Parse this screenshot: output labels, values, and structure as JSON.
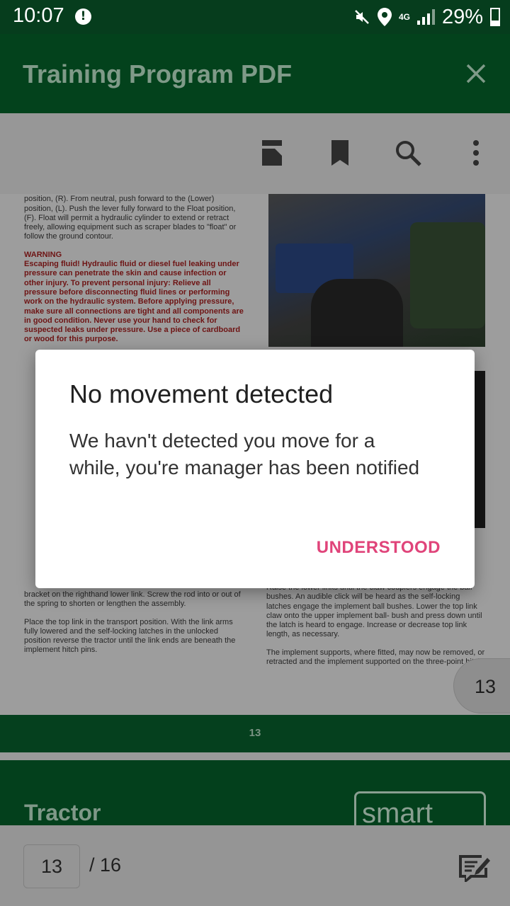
{
  "status_bar": {
    "time": "10:07",
    "network": "4G",
    "battery": "29%"
  },
  "app_bar": {
    "title": "Training Program PDF"
  },
  "toolbar": {
    "icons": [
      "page-layout-icon",
      "bookmark-icon",
      "search-icon",
      "more-vert-icon"
    ]
  },
  "pdf": {
    "left_column": [
      "Pull the lever back from the neutral position, (N), to the Raise position, (R). From neutral, push forward to the (Lower) position, (L). Push the lever fully forward to the Float position, (F). Float will permit a hydraulic cylinder to extend or retract freely, allowing equipment such as scraper blades to \"float\" or follow the ground contour."
    ],
    "warning_heading": "WARNING",
    "warning_text": "Escaping fluid! Hydraulic fluid or diesel fuel leaking under pressure can penetrate the skin and cause infection or other injury. To prevent personal injury: Relieve all pressure before disconnecting fluid lines or performing work on the hydraulic system. Before applying pressure, make sure all connections are tight and all components are in good condition. Never use your hand to check for suspected leaks under pressure. Use a piece of cardboard or wood for this purpose.",
    "left_bottom": [
      "bracket on the righthand lower link. Screw the rod into or out of the spring to shorten or lengthen the assembly.",
      "Place the top link in the transport position. With the link arms fully lowered and the self-locking latches in the unlocked position reverse the tractor until the link ends are beneath the implement hitch pins."
    ],
    "right_bottom": [
      "Raise the lower links until the claw couplers engage the ball bushes. An audible click will be heard as the self-locking latches engage the implement ball bushes. Lower the top link claw onto the upper implement ball- bush and press down until the latch is heard to engage. Increase or decrease top link length, as necessary.",
      "The implement supports, where fitted, may now be removed, or retracted and the implement supported on the three-point hitch."
    ],
    "floating_page_number": "13",
    "page_band_number": "13",
    "next_page_heading": "Tractor",
    "next_page_logo": "smart"
  },
  "dialog": {
    "title": "No movement detected",
    "message": "We havn't detected you move for a while, you're manager has been notified",
    "button": "UNDERSTOOD",
    "button_color": "#e0447a"
  },
  "bottom_bar": {
    "current_page": "13",
    "total_pages": "/ 16"
  }
}
